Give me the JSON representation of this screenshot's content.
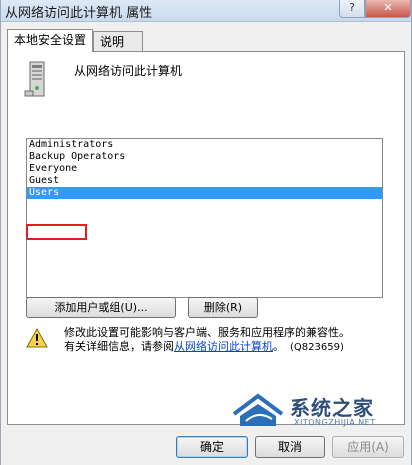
{
  "window": {
    "title": "从网络访问此计算机 属性",
    "help_label": "?",
    "close_label": "✕"
  },
  "tabs": [
    {
      "label": "本地安全设置",
      "active": true
    },
    {
      "label": "说明",
      "active": false
    }
  ],
  "policy": {
    "title": "从网络访问此计算机",
    "icon": "server-icon"
  },
  "accounts": {
    "items": [
      "Administrators",
      "Backup Operators",
      "Everyone",
      "Guest",
      "Users"
    ],
    "selected": "Users",
    "highlighted": "Guest"
  },
  "actions": {
    "add_label": "添加用户或组(U)...",
    "remove_label": "删除(R)"
  },
  "warning": {
    "line1": "修改此设置可能影响与客户端、服务和应用程序的兼容性。",
    "line2_prefix": "有关详细信息，请参阅",
    "link": "从网络访问此计算机",
    "link_suffix": "。",
    "kb": "(Q823659)",
    "icon": "warning-icon"
  },
  "watermark": {
    "text": "系统之家",
    "url": "XITONGZHIJIA.NET"
  },
  "footer": {
    "ok_label": "确定",
    "cancel_label": "取消",
    "apply_label": "应用(A)"
  },
  "colors": {
    "selection": "#3399ff",
    "highlight_border": "#e02020",
    "link": "#0645c8"
  }
}
